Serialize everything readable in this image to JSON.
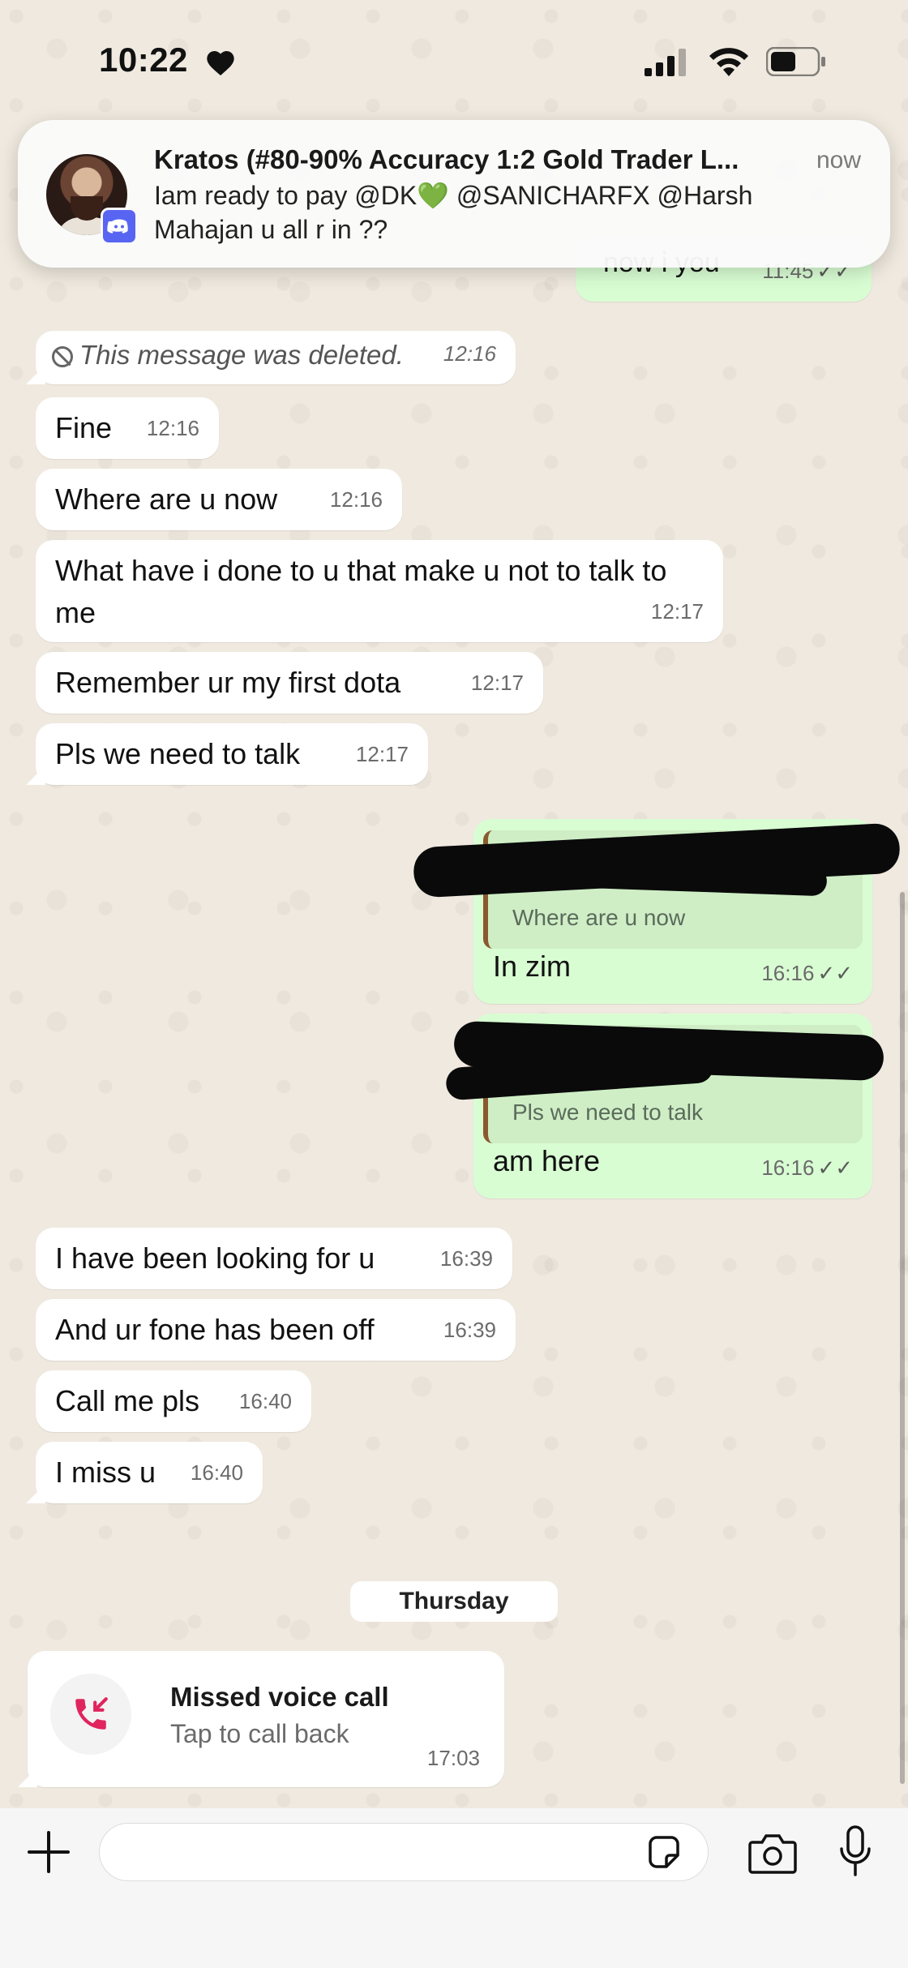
{
  "status_bar": {
    "time": "10:22"
  },
  "notification": {
    "title": "Kratos (#80-90% Accuracy 1:2 Gold Trader L...",
    "time": "now",
    "line1": "Iam ready to pay @DK💚  @SANICHARFX @Harsh",
    "line2": "Mahajan  u all r in ??"
  },
  "partial_message": {
    "text": "now i you",
    "time": "11:45"
  },
  "messages_in_1": [
    {
      "text": "This message was deleted.",
      "time": "12:16"
    },
    {
      "text": "Fine",
      "time": "12:16"
    },
    {
      "text": "Where are u now",
      "time": "12:16"
    },
    {
      "text": "What have i done to u that make u not to talk to me",
      "time": "12:17"
    },
    {
      "text": "Remember ur my first dota",
      "time": "12:17"
    },
    {
      "text": "Pls we need to talk",
      "time": "12:17"
    }
  ],
  "reply_1": {
    "quoted": "Where are u now",
    "text": "In zim",
    "time": "16:16"
  },
  "reply_2": {
    "quoted": "Pls we need to talk",
    "text": "am here",
    "time": "16:16"
  },
  "messages_in_2": [
    {
      "text": "I have been looking for u",
      "time": "16:39"
    },
    {
      "text": "And ur fone has been off",
      "time": "16:39"
    },
    {
      "text": "Call me pls",
      "time": "16:40"
    },
    {
      "text": "I miss u",
      "time": "16:40"
    }
  ],
  "day_chip": "Thursday",
  "missed_call": {
    "title": "Missed voice call",
    "subtitle": "Tap to call back",
    "time": "17:03"
  },
  "composer": {
    "placeholder": ""
  },
  "colors": {
    "outgoing": "#d9fdd3",
    "incoming": "#ffffff",
    "missed_call_red": "#e0245e"
  }
}
